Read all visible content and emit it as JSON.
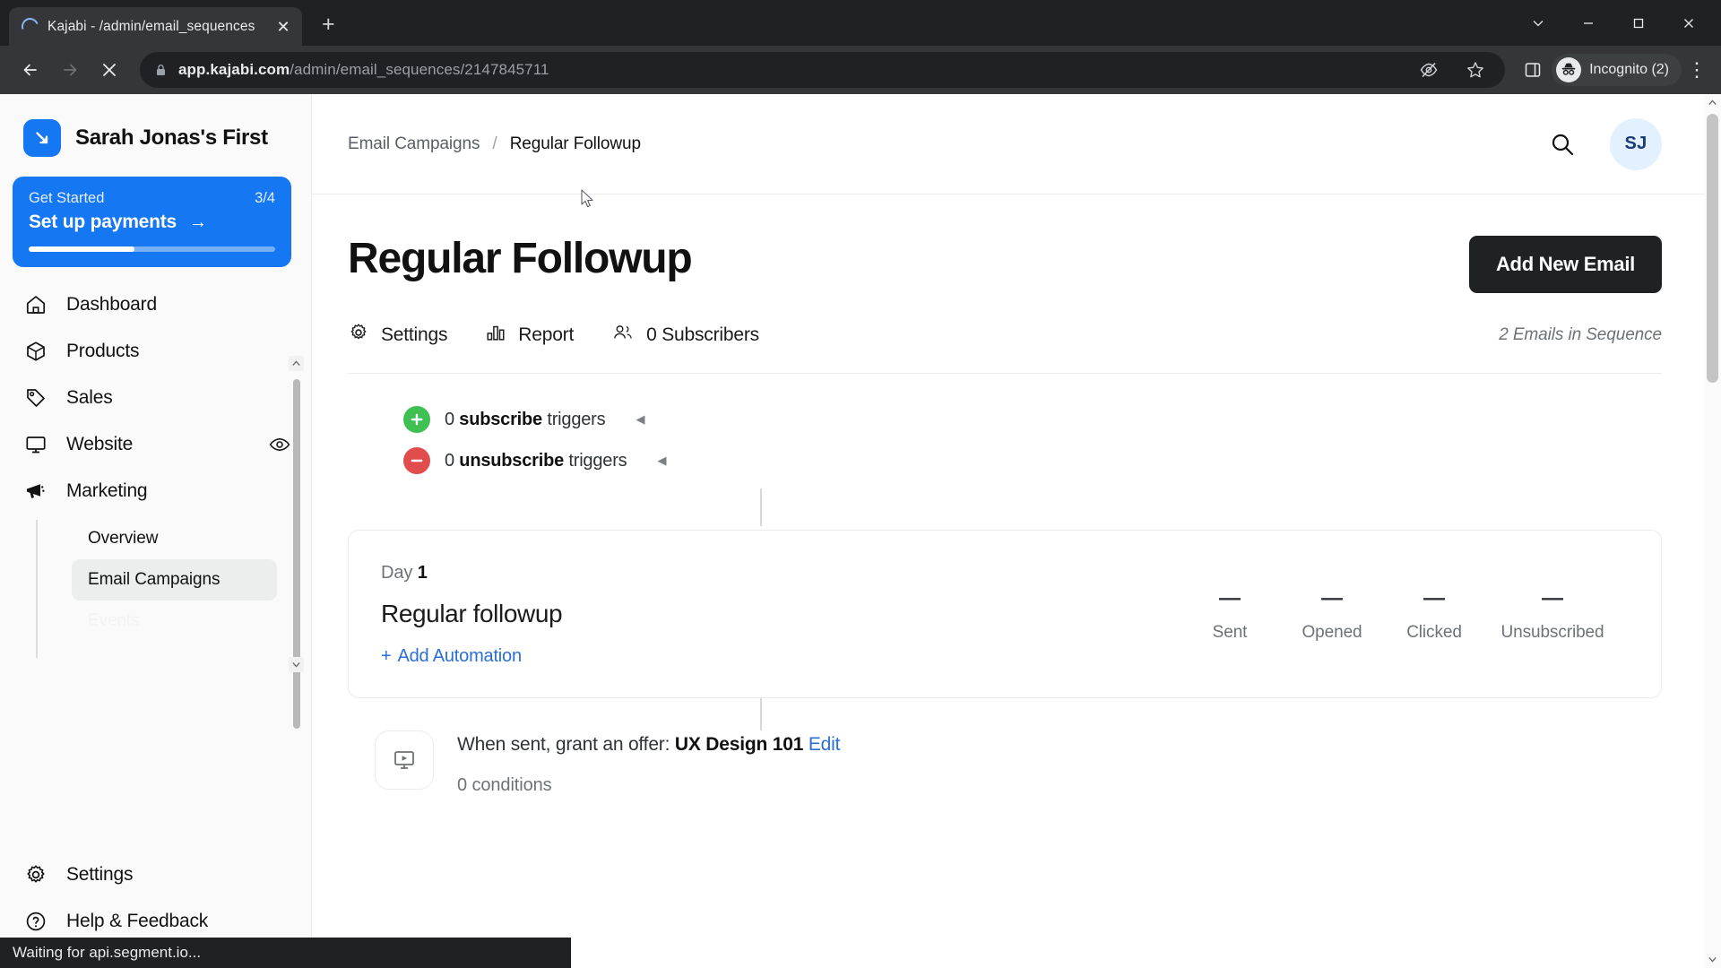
{
  "browser": {
    "tab": {
      "title": "Kajabi - /admin/email_sequences",
      "close_label": "✕"
    },
    "newtab_label": "+",
    "url_domain": "app.kajabi.com",
    "url_path": "/admin/email_sequences/2147845711",
    "profile_label": "Incognito (2)",
    "status_text": "Waiting for api.segment.io..."
  },
  "sidebar": {
    "brand_name": "Sarah Jonas's First",
    "get_started": {
      "label": "Get Started",
      "progress_text": "3/4",
      "cta": "Set up payments",
      "arrow": "→",
      "progress_percent": 43
    },
    "items": [
      {
        "label": "Dashboard",
        "icon": "home-icon"
      },
      {
        "label": "Products",
        "icon": "box-icon"
      },
      {
        "label": "Sales",
        "icon": "tag-icon"
      },
      {
        "label": "Website",
        "icon": "monitor-icon",
        "trailing_icon": "eye-icon"
      },
      {
        "label": "Marketing",
        "icon": "megaphone-icon"
      }
    ],
    "subitems": [
      {
        "label": "Overview",
        "active": false
      },
      {
        "label": "Email Campaigns",
        "active": true
      },
      {
        "label": "Events",
        "active": false,
        "clipped": true
      }
    ],
    "bottom_items": [
      {
        "label": "Settings",
        "icon": "gear-icon"
      },
      {
        "label": "Help & Feedback",
        "icon": "question-circle-icon"
      }
    ]
  },
  "topbar": {
    "breadcrumb_parent": "Email Campaigns",
    "breadcrumb_sep": "/",
    "breadcrumb_current": "Regular Followup",
    "avatar_initials": "SJ"
  },
  "main": {
    "page_title": "Regular Followup",
    "add_button": "Add New Email",
    "sequence_count": "2 Emails in Sequence",
    "tabs": [
      {
        "label": "Settings",
        "icon": "gear-icon"
      },
      {
        "label": "Report",
        "icon": "bar-chart-icon"
      },
      {
        "label": "0 Subscribers",
        "icon": "people-icon"
      }
    ],
    "triggers": [
      {
        "count": "0",
        "kind": "subscribe",
        "suffix": "triggers",
        "type": "plus"
      },
      {
        "count": "0",
        "kind": "unsubscribe",
        "suffix": "triggers",
        "type": "minus"
      }
    ],
    "email_card": {
      "day_prefix": "Day",
      "day_number": "1",
      "name": "Regular followup",
      "add_automation": "Add Automation",
      "add_automation_plus": "+",
      "stats": [
        {
          "value": "—",
          "label": "Sent"
        },
        {
          "value": "—",
          "label": "Opened"
        },
        {
          "value": "—",
          "label": "Clicked"
        },
        {
          "value": "—",
          "label": "Unsubscribed"
        }
      ]
    },
    "automation": {
      "prefix": "When sent, grant an offer:",
      "offer": "UX Design 101",
      "edit_label": "Edit",
      "conditions": "0 conditions",
      "icon": "video-screen-icon"
    }
  },
  "colors": {
    "brand_blue": "#1677f2",
    "link_blue": "#2a6fd6",
    "dark_button": "#1f2123",
    "success_green": "#3ec152",
    "danger_red": "#e14c4c"
  }
}
